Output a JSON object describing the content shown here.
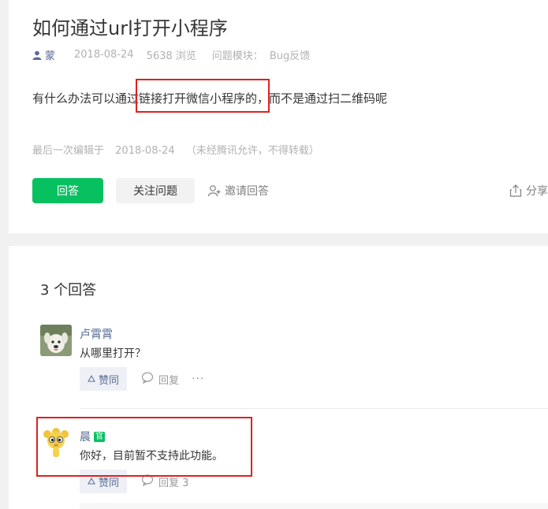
{
  "question": {
    "title": "如何通过url打开小程序",
    "author": "蒙",
    "date": "2018-08-24",
    "views": "5638 浏览",
    "module_label": "问题模块：",
    "module_value": "Bug反馈",
    "body": "有什么办法可以通过链接打开微信小程序的，而不是通过扫二维码呢",
    "edit_label": "最后一次编辑于",
    "edit_date": "2018-08-24",
    "edit_note": "（未经腾讯允许，不得转载）"
  },
  "actions": {
    "answer": "回答",
    "follow": "关注问题",
    "invite": "邀请回答",
    "share": "分享"
  },
  "answers_count": "3 个回答",
  "answers": [
    {
      "name": "卢霄霄",
      "text": "从哪里打开？",
      "like": "赞同",
      "reply": "回复",
      "more": "···"
    },
    {
      "name": "晨",
      "badge": "官",
      "text": "你好，目前暂不支持此功能。",
      "like": "赞同",
      "reply": "回复 3",
      "more": "···"
    }
  ],
  "colors": {
    "primary": "#07c160",
    "link": "#576b95",
    "highlight": "#e02020"
  }
}
